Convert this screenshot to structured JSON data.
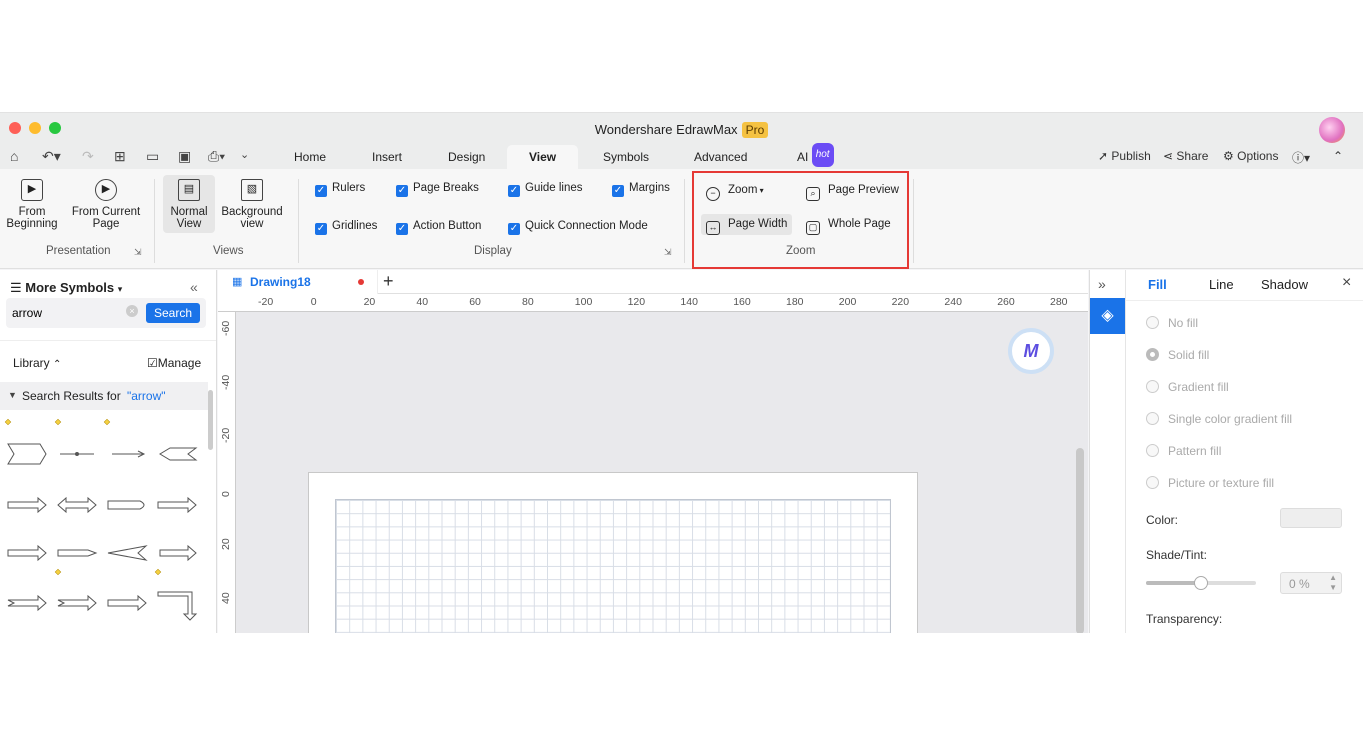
{
  "window": {
    "title": "Wondershare EdrawMax",
    "badge": "Pro"
  },
  "menubar": {
    "tabs": [
      "Home",
      "Insert",
      "Design",
      "View",
      "Symbols",
      "Advanced",
      "AI"
    ],
    "active_tab": "View",
    "ai_badge": "hot",
    "right": {
      "publish": "Publish",
      "share": "Share",
      "options": "Options"
    }
  },
  "ribbon": {
    "presentation": {
      "from_beginning": "From\nBeginning",
      "from_current": "From Current\nPage",
      "group": "Presentation"
    },
    "views": {
      "normal": "Normal\nView",
      "background": "Background\nview",
      "group": "Views"
    },
    "display": {
      "rulers": "Rulers",
      "page_breaks": "Page Breaks",
      "guide_lines": "Guide lines",
      "margins": "Margins",
      "gridlines": "Gridlines",
      "action_button": "Action Button",
      "quick_connection": "Quick Connection Mode",
      "group": "Display"
    },
    "zoom": {
      "zoom": "Zoom",
      "page_preview": "Page Preview",
      "page_width": "Page Width",
      "whole_page": "Whole Page",
      "group": "Zoom"
    }
  },
  "left_panel": {
    "title": "More Symbols",
    "search_value": "arrow",
    "search_button": "Search",
    "library": "Library",
    "manage": "Manage",
    "results_prefix": "Search Results for",
    "results_term": "\"arrow\""
  },
  "canvas": {
    "doc_tab": "Drawing18",
    "h_ticks": [
      "-20",
      "0",
      "20",
      "40",
      "60",
      "80",
      "100",
      "120",
      "140",
      "160",
      "180",
      "200",
      "220",
      "240",
      "260",
      "280"
    ],
    "v_ticks": [
      "-60",
      "-40",
      "-20",
      "0",
      "20",
      "40"
    ]
  },
  "right_panel": {
    "tabs": [
      "Fill",
      "Line",
      "Shadow"
    ],
    "active_tab": "Fill",
    "fill_options": [
      "No fill",
      "Solid fill",
      "Gradient fill",
      "Single color gradient fill",
      "Pattern fill",
      "Picture or texture fill"
    ],
    "color_label": "Color:",
    "shade_label": "Shade/Tint:",
    "shade_value": "0 %",
    "transparency_label": "Transparency:"
  },
  "colors": {
    "accent": "#1a73e8",
    "highlight": "#e53935"
  }
}
